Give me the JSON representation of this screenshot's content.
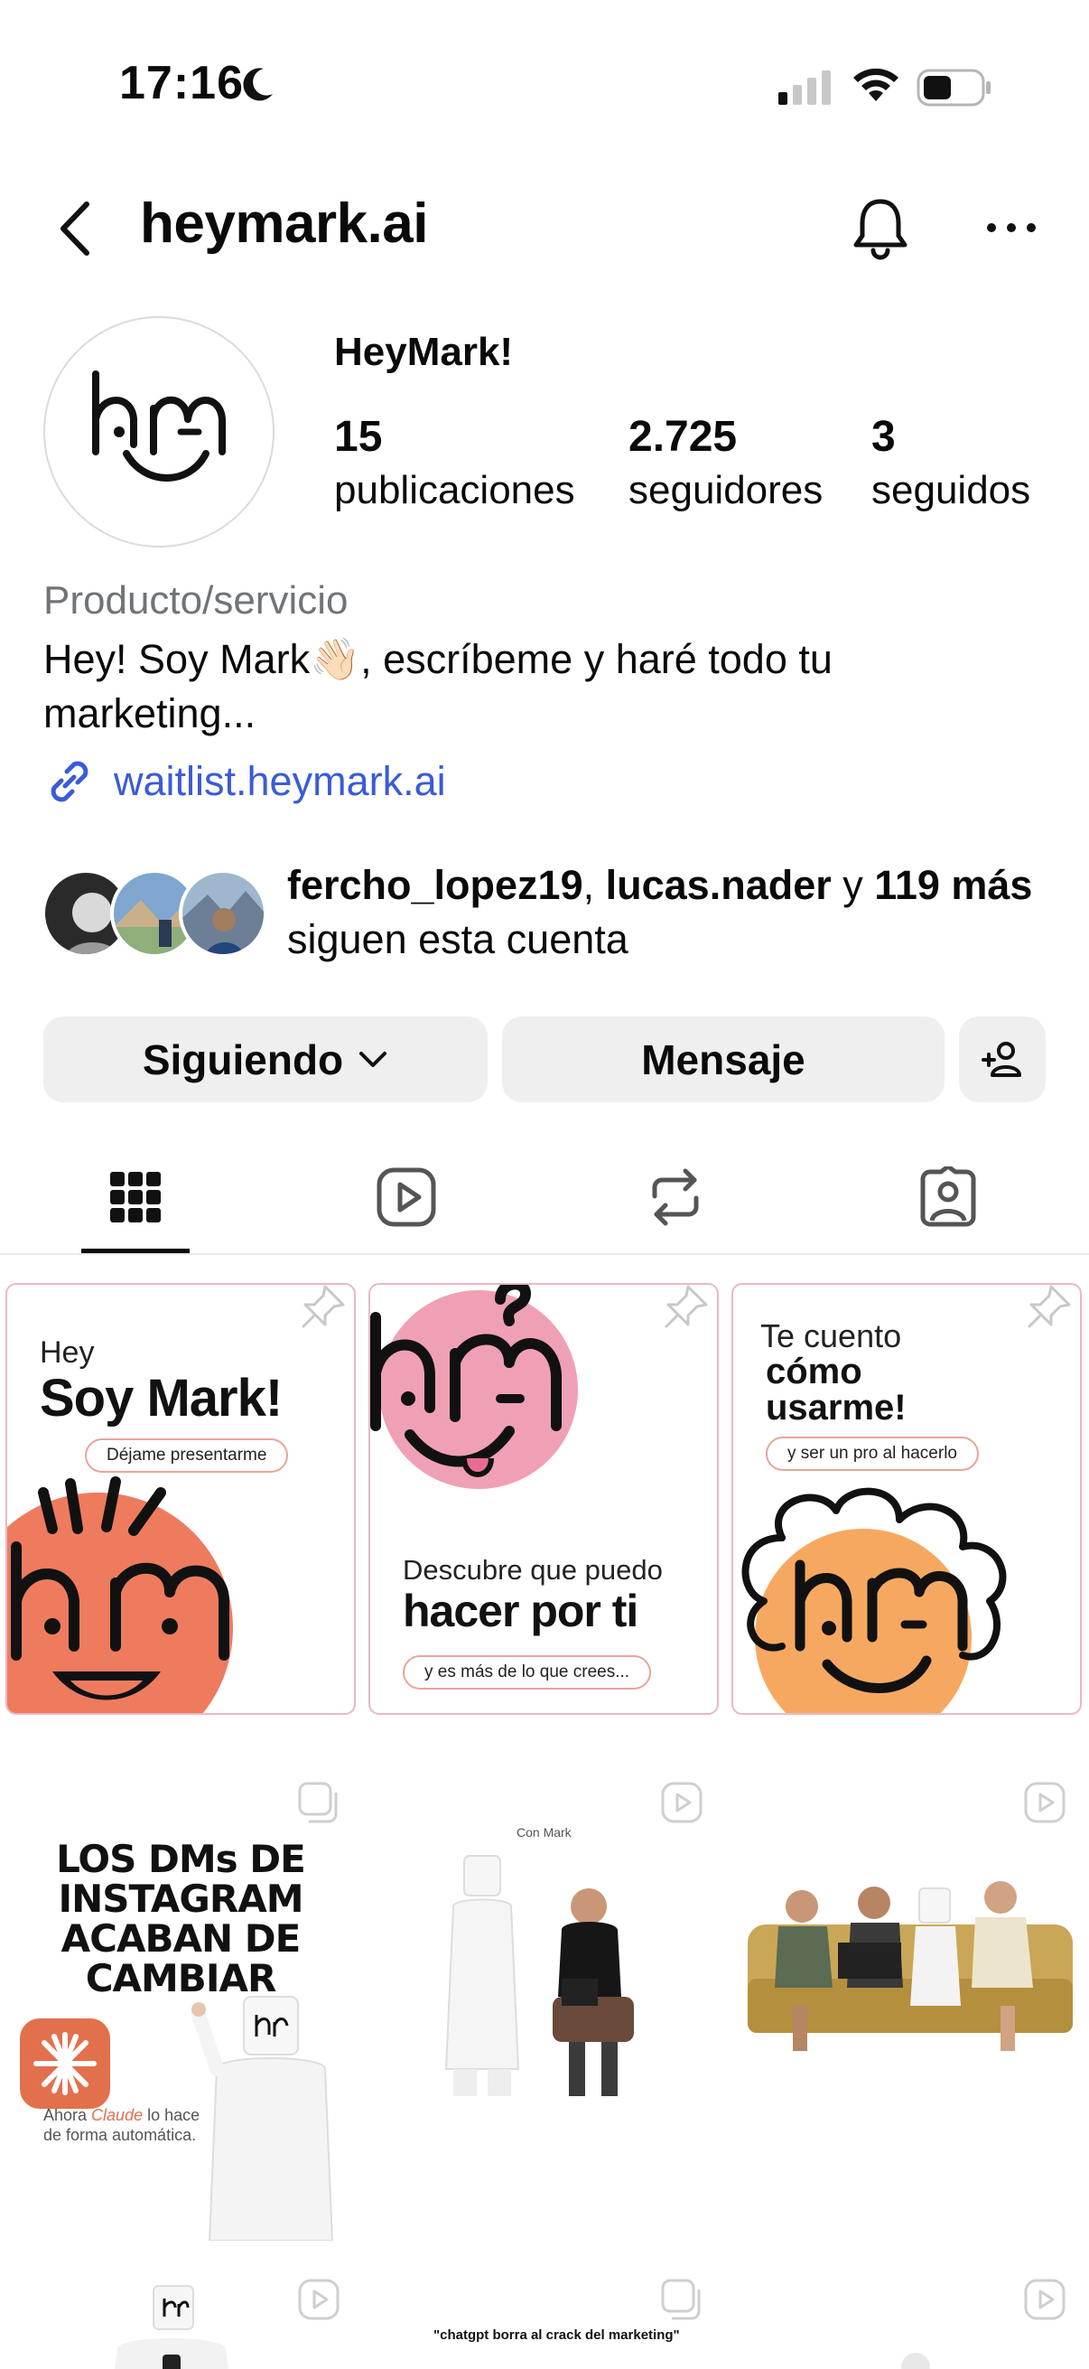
{
  "status_bar": {
    "time": "17:16"
  },
  "header": {
    "handle": "heymark.ai"
  },
  "profile": {
    "display_name": "HeyMark!",
    "stats": [
      {
        "value": "15",
        "label": "publicaciones"
      },
      {
        "value": "2.725",
        "label": "seguidores"
      },
      {
        "value": "3",
        "label": "seguidos"
      }
    ],
    "category": "Producto/servicio",
    "bio": "Hey! Soy Mark👋🏻, escríbeme y haré todo tu marketing...",
    "link": "waitlist.heymark.ai"
  },
  "followed_by": {
    "user1": "fercho_lopez19",
    "sep": ", ",
    "user2": "lucas.nader",
    "conj": " y ",
    "others": "119 más",
    "suffix": " siguen esta cuenta"
  },
  "actions": {
    "following_label": "Siguiendo",
    "message_label": "Mensaje"
  },
  "posts": {
    "p1": {
      "small": "Hey",
      "big": "Soy Mark!",
      "pill": "Déjame presentarme"
    },
    "p2": {
      "small": "Descubre que puedo",
      "big": "hacer por ti",
      "pill": "y es más de lo que crees..."
    },
    "p3": {
      "small": "Te cuento",
      "big1": "cómo",
      "big2": "usarme!",
      "pill": "y ser un pro al hacerlo"
    },
    "p4": {
      "title": "LOS DMs DE INSTAGRAM ACABAN DE CAMBIAR",
      "note1": "Ahora ",
      "note_brand": "Claude",
      "note2": " lo hace de forma automática."
    },
    "p5": {
      "caption": "Con Mark"
    },
    "p8": {
      "caption": "\"chatgpt borra al crack del marketing\""
    }
  },
  "colors": {
    "link": "#3a5bd9",
    "button_bg": "#efefef",
    "salmon": "#ef7b5f",
    "pink": "#f0a0b5",
    "orange": "#f7a860"
  }
}
